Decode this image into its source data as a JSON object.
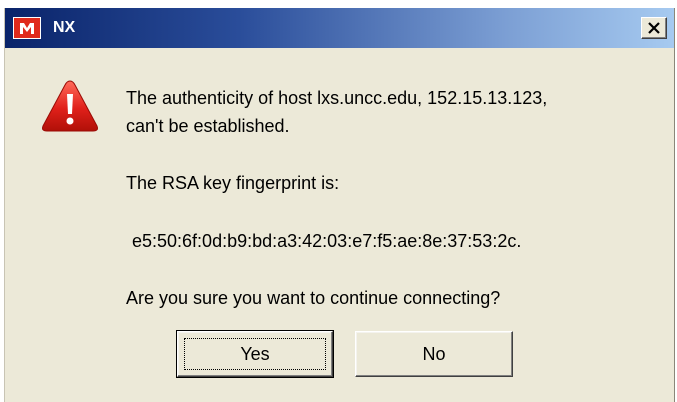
{
  "window": {
    "title": "NX",
    "logo_icon": "nx-app-logo-icon",
    "close_icon": "close-x-icon"
  },
  "dialog": {
    "icon": "warning-triangle-icon",
    "message_line1": "The authenticity of host lxs.uncc.edu, 152.15.13.123,",
    "message_line2": "can't be established.",
    "fingerprint_label": "The RSA key fingerprint is:",
    "fingerprint_value": "e5:50:6f:0d:b9:bd:a3:42:03:e7:f5:ae:8e:37:53:2c.",
    "question": "Are you sure you want to continue connecting?"
  },
  "buttons": {
    "yes_label": "Yes",
    "no_label": "No"
  },
  "colors": {
    "titlebar_start": "#0a246a",
    "titlebar_end": "#a6caf0",
    "dialog_bg": "#ece9d8",
    "warning_red": "#e0201a",
    "logo_red": "#e02a1c"
  }
}
